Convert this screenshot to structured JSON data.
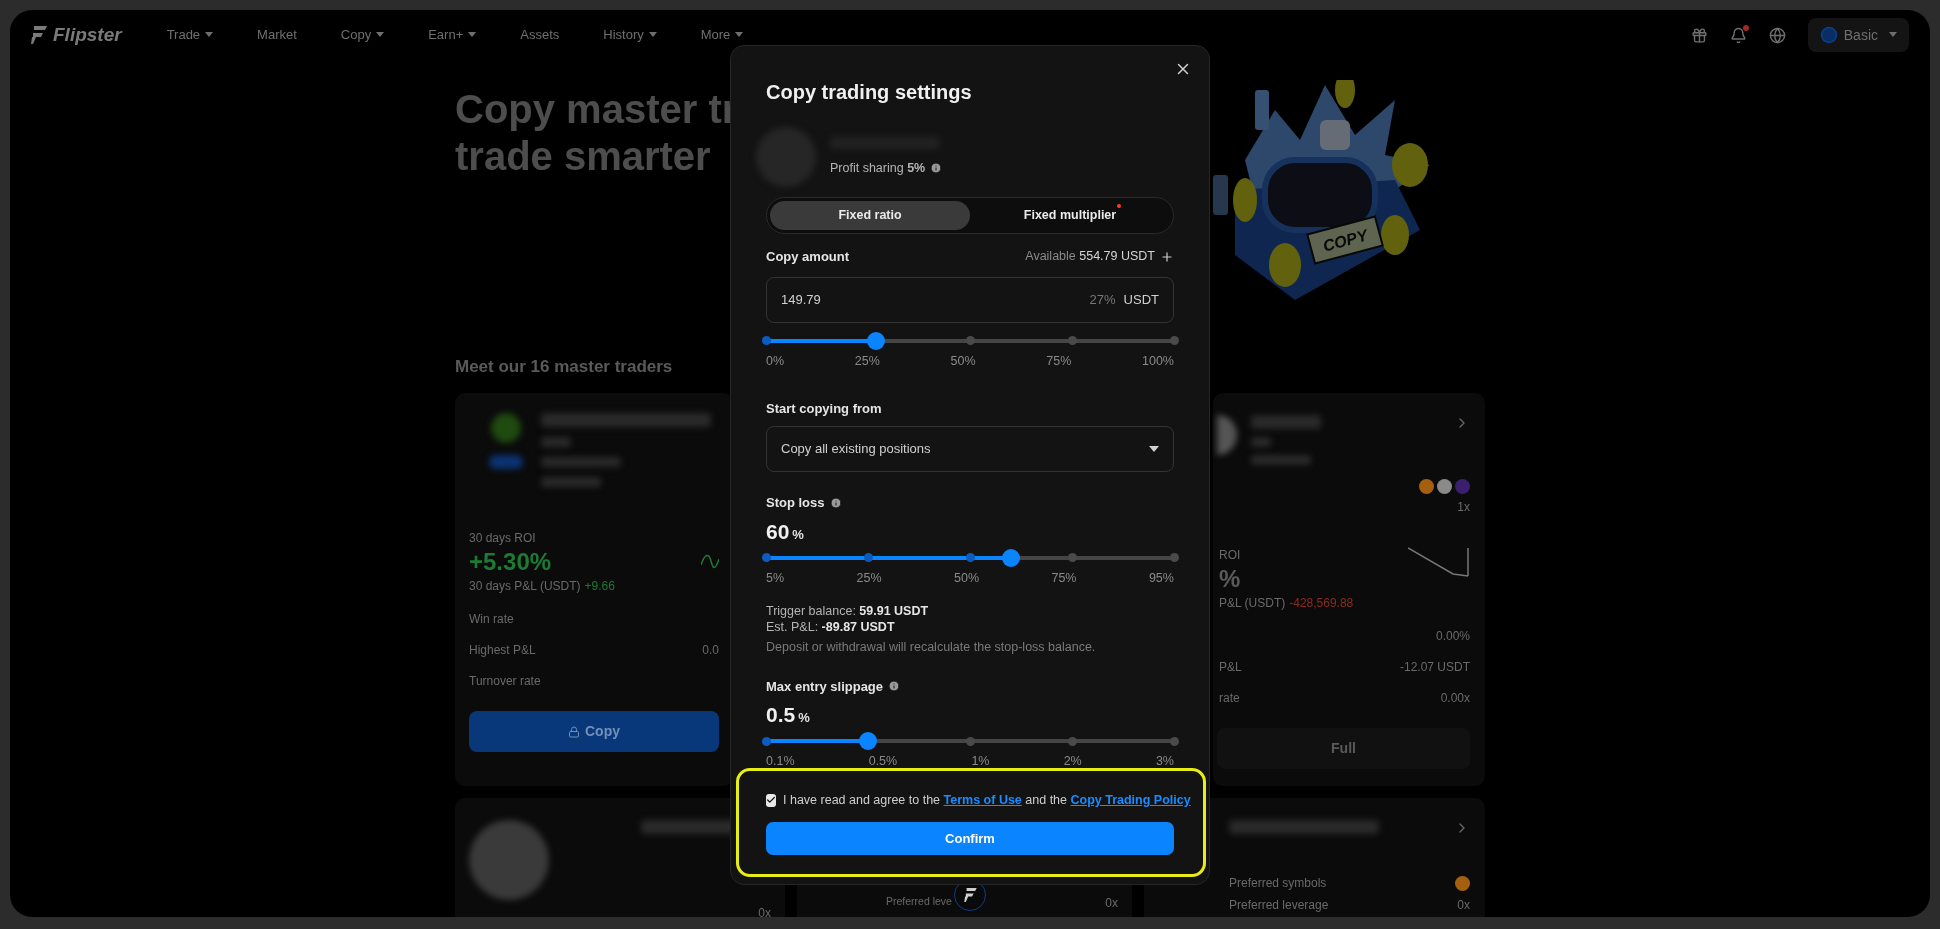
{
  "nav": {
    "logo": "Flipster",
    "items": [
      {
        "label": "Trade",
        "dropdown": true
      },
      {
        "label": "Market",
        "dropdown": false
      },
      {
        "label": "Copy",
        "dropdown": true
      },
      {
        "label": "Earn+",
        "dropdown": true
      },
      {
        "label": "Assets",
        "dropdown": false
      },
      {
        "label": "History",
        "dropdown": true
      },
      {
        "label": "More",
        "dropdown": true
      }
    ],
    "notification_dot": true,
    "account": "Basic"
  },
  "hero": {
    "title_lines": [
      "Copy master tr",
      "trade smarter"
    ],
    "illustration_label": "COPY"
  },
  "section_title": "Meet our 16 master traders",
  "left_card": {
    "roi_label": "30 days ROI",
    "roi": "+5.30%",
    "pnl_label": "30 days P&L (USDT)",
    "pnl": "+9.66",
    "stats": [
      {
        "label": "Win rate"
      },
      {
        "label": "Highest P&L",
        "value": "0.0"
      },
      {
        "label": "Turnover rate"
      }
    ],
    "button": "Copy"
  },
  "right_card": {
    "leverage": "1x",
    "roi_label": "ROI",
    "roi": "%",
    "pnl_label": "P&L (USDT)",
    "pnl": "-428,569.88",
    "stats": [
      {
        "value": "0.00%"
      },
      {
        "label": "P&L",
        "value": "-12.07 USDT"
      },
      {
        "label": "rate",
        "value": "0.00x"
      }
    ],
    "button": "Full"
  },
  "bottom_cards": {
    "left": {
      "leverage": "0x"
    },
    "middle": {
      "leverage_label": "Preferred leve",
      "leverage": "0x"
    },
    "right": {
      "symbols_label": "Preferred symbols",
      "leverage_label": "Preferred leverage",
      "leverage": "0x"
    }
  },
  "modal": {
    "title": "Copy trading settings",
    "profit_sharing": "Profit sharing **5%**",
    "modes": [
      {
        "label": "Fixed ratio",
        "selected": true,
        "new_dot": false
      },
      {
        "label": "Fixed multiplier",
        "selected": false,
        "new_dot": true
      }
    ],
    "copy_amount": {
      "label": "Copy amount",
      "available": "Available **554.79 USDT**",
      "value": "149.79",
      "percent": "27%",
      "unit": "USDT"
    },
    "amount_slider": {
      "level": 0.27,
      "ticks": [
        "0%",
        "25%",
        "50%",
        "75%",
        "100%"
      ]
    },
    "start_copying": {
      "label": "Start copying from",
      "value": "Copy all existing positions"
    },
    "stop_loss": {
      "label": "Stop loss",
      "value": "60",
      "unit": "%",
      "level": 0.6,
      "ticks": [
        "5%",
        "25%",
        "50%",
        "75%",
        "95%"
      ],
      "trigger": "Trigger balance: **59.91 USDT**",
      "est_pnl": "Est. P&L: **-89.87 USDT**",
      "note": "Deposit or withdrawal will recalculate the stop-loss balance."
    },
    "slippage": {
      "label": "Max entry slippage",
      "value": "0.5",
      "unit": "%",
      "level": 0.25,
      "ticks": [
        "0.1%",
        "0.5%",
        "1%",
        "2%",
        "3%"
      ]
    },
    "agreement": {
      "checked": true,
      "parts": [
        {
          "kind": "text",
          "text": "I have read and agree to the"
        },
        {
          "kind": "link",
          "text": "Terms of Use"
        },
        {
          "kind": "text",
          "text": "and the"
        },
        {
          "kind": "link",
          "text": "Copy Trading Policy"
        }
      ]
    },
    "confirm": "Confirm",
    "highlighted": true
  }
}
